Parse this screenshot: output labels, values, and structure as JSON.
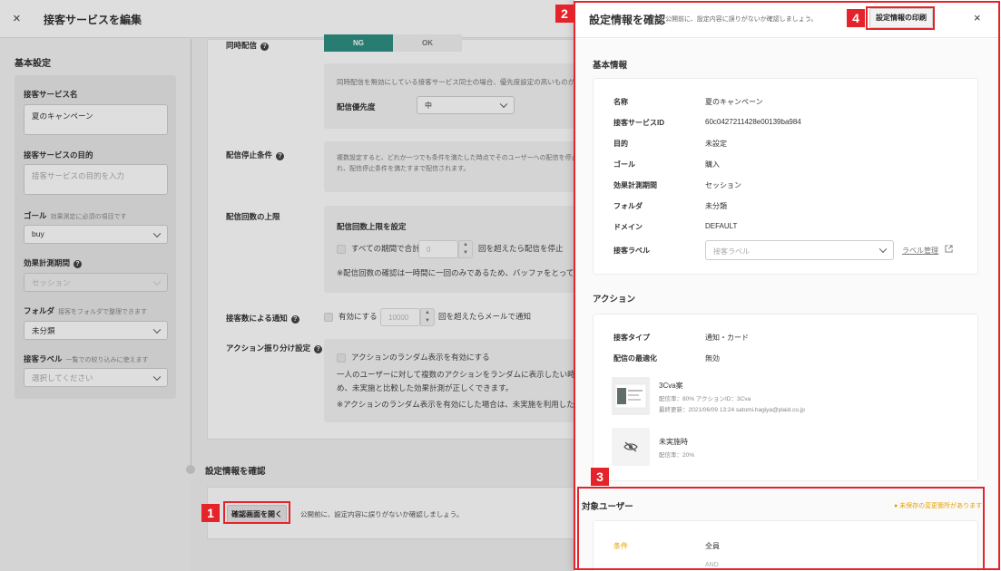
{
  "editor": {
    "title": "接客サービスを編集",
    "close_icon": "×",
    "basic_settings": "基本設定",
    "service_name_label": "接客サービス名",
    "service_name_value": "夏のキャンペーン",
    "purpose_label": "接客サービスの目的",
    "purpose_placeholder": "接客サービスの目的を入力",
    "goal_label": "ゴール",
    "goal_hint": "効果測定に必須の項目です",
    "goal_value": "buy",
    "period_label": "効果計測期間",
    "period_value": "セッション",
    "folder_label": "フォルダ",
    "folder_hint": "接客をフォルダで整理できます",
    "folder_value": "未分類",
    "label_label": "接客ラベル",
    "label_hint": "一覧での絞り込みに使えます",
    "label_placeholder": "選択してください"
  },
  "main": {
    "simultaneous_label": "同時配信",
    "ng_label": "NG",
    "ok_label": "OK",
    "simultaneous_note": "同時配信を無効にしている接客サービス同士の場合、優先度設定の高いものが一つだけ配信",
    "priority_label": "配信優先度",
    "priority_value": "中",
    "stop_label": "配信停止条件",
    "stop_note_1": "複数設定すると、どれか一つでも条件を満たした時点でそのユーザーへの配信を停止します",
    "stop_note_2": "れ、配信停止条件を満たすまで配信されます。",
    "limit_label": "配信回数の上限",
    "limit_heading": "配信回数上限を設定",
    "limit_checkbox": "すべての期間で合計",
    "limit_number": "0",
    "limit_suffix": "回を超えたら配信を停止",
    "limit_note": "※配信回数の確認は一時間に一回のみであるため、バッファをとって設定し",
    "notify_label": "接客数による通知",
    "notify_checkbox": "有効にする",
    "notify_number": "10000",
    "notify_suffix": "回を超えたらメールで通知",
    "split_label": "アクション振り分け設定",
    "split_checkbox": "アクションのランダム表示を有効にする",
    "split_note_1": "一人のユーザーに対して複数のアクションをランダムに表示したい時に有効",
    "split_note_2": "め、未実施と比較した効果計測が正しくできます。",
    "split_note_3": "※アクションのランダム表示を有効にした場合は、未実施を利用した効果計"
  },
  "confirm": {
    "section_title": "設定情報を確認",
    "open_button": "確認画面を開く",
    "hint": "公開前に、設定内容に誤りがないか確認しましょう。"
  },
  "drawer": {
    "title": "設定情報を確認",
    "subtitle": "公開前に、設定内容に誤りがないか確認しましょう。",
    "print_button": "設定情報の印刷",
    "close_icon": "×",
    "basic_info_heading": "基本情報",
    "basic_rows": [
      {
        "label": "名称",
        "value": "夏のキャンペーン"
      },
      {
        "label": "接客サービスID",
        "value": "60c0427211428e00139ba984"
      },
      {
        "label": "目的",
        "value": "未設定"
      },
      {
        "label": "ゴール",
        "value": "購入"
      },
      {
        "label": "効果計測期間",
        "value": "セッション"
      },
      {
        "label": "フォルダ",
        "value": "未分類"
      },
      {
        "label": "ドメイン",
        "value": "DEFAULT"
      }
    ],
    "label_row_label": "接客ラベル",
    "label_placeholder": "接客ラベル",
    "label_manage_link": "ラベル管理",
    "action_heading": "アクション",
    "action_rows": [
      {
        "label": "接客タイプ",
        "value": "通知・カード"
      },
      {
        "label": "配信の最適化",
        "value": "無効"
      }
    ],
    "actions": [
      {
        "name": "3Cva案",
        "meta_1": "配信率：80%  アクションID：3Cva",
        "meta_2": "最終更新：2021/06/09 13:24 satomi.hagiya@plaid.co.jp"
      },
      {
        "name": "未実施時",
        "meta_1": "配信率：20%",
        "meta_2": ""
      }
    ],
    "target_users_heading": "対象ユーザー",
    "unsaved_badge": "● 未保存の変更箇所があります",
    "condition_label": "条件",
    "condition_value": "全員",
    "and_label": "AND"
  },
  "callouts": [
    "1",
    "2",
    "3",
    "4"
  ],
  "colors": {
    "accent_green": "#2f8f83",
    "callout_red": "#e4242a",
    "warning_orange": "#e8a000"
  }
}
